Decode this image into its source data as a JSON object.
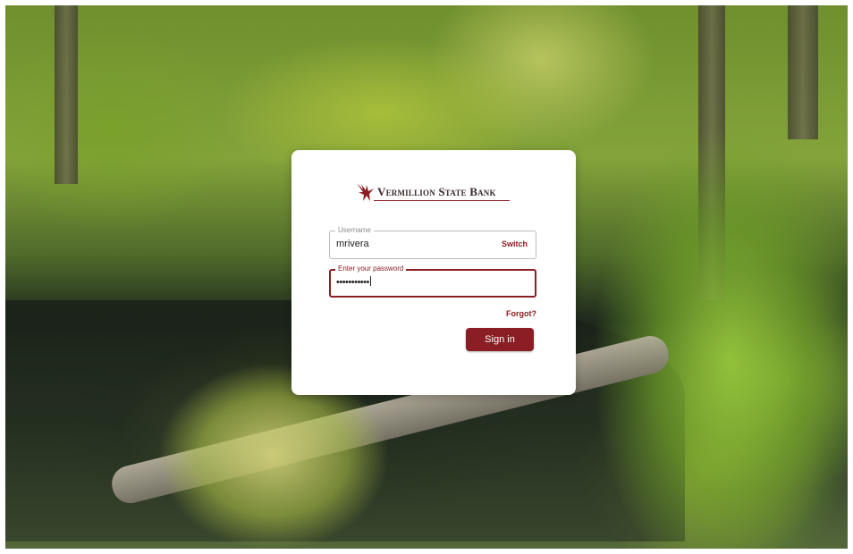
{
  "brand": {
    "name": "Vermillion State Bank",
    "accent_color": "#8b1e24",
    "logo_icon": "eagle-icon"
  },
  "login": {
    "username_label": "Username",
    "username_value": "mrivera",
    "switch_label": "Switch",
    "password_label": "Enter your password",
    "password_masked": "•••••••••••",
    "forgot_label": "Forgot?",
    "signin_label": "Sign in"
  },
  "background": {
    "scene": "forest-creek-photo"
  }
}
